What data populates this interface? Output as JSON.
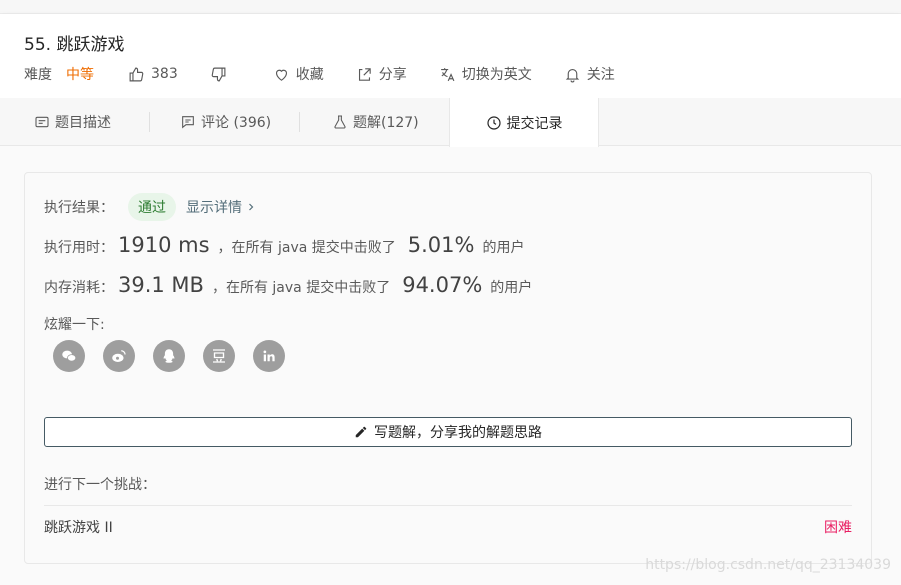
{
  "problem": {
    "title": "55. 跳跃游戏",
    "difficulty_label": "难度",
    "difficulty_value": "中等",
    "likes": "383",
    "collect_label": "收藏",
    "share_label": "分享",
    "switch_lang_label": "切换为英文",
    "follow_label": "关注"
  },
  "tabs": [
    {
      "label": "题目描述"
    },
    {
      "label": "评论 (396)"
    },
    {
      "label": "题解(127)"
    },
    {
      "label": "提交记录"
    }
  ],
  "result": {
    "result_label": "执行结果：",
    "status": "通过",
    "details_link": "显示详情",
    "time_label": "执行用时：",
    "time_value": "1910 ms",
    "time_mid": "，在所有 java 提交中击败了",
    "time_percent": "5.01%",
    "time_suffix": "的用户",
    "mem_label": "内存消耗：",
    "mem_value": "39.1 MB",
    "mem_mid": "，在所有 java 提交中击败了",
    "mem_percent": "94.07%",
    "mem_suffix": "的用户",
    "share_label": "炫耀一下:",
    "write_button": "写题解，分享我的解题思路",
    "next_label": "进行下一个挑战：",
    "next_problem": "跳跃游戏 II",
    "next_difficulty": "困难"
  },
  "watermark": "https://blog.csdn.net/qq_23134039",
  "colors": {
    "difficulty_medium": "#ef6c00",
    "difficulty_hard": "#e91e63",
    "success": "#2e7d32"
  },
  "icons": {
    "share": [
      "wechat-icon",
      "weibo-icon",
      "qq-icon",
      "douban-icon",
      "linkedin-icon"
    ]
  }
}
